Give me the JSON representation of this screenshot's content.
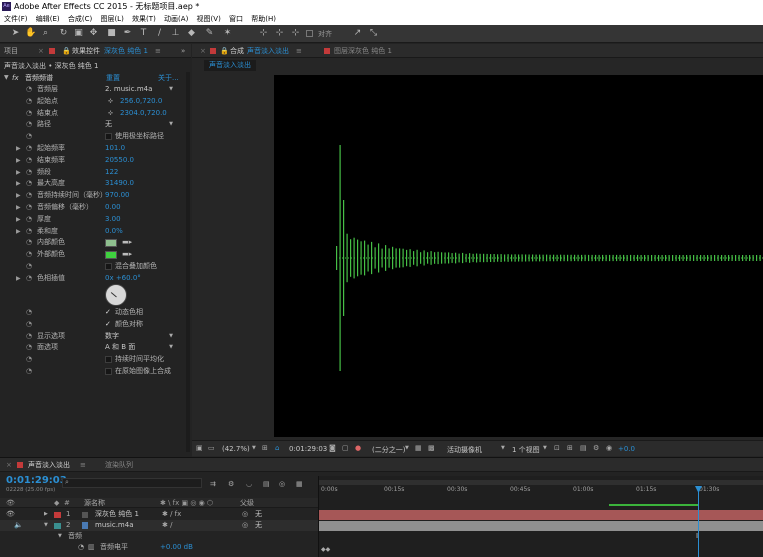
{
  "app": {
    "title": "Adobe After Effects CC 2015 - 无标题项目.aep *",
    "logo": "Ae"
  },
  "menu": [
    "文件(F)",
    "编辑(E)",
    "合成(C)",
    "图层(L)",
    "效果(T)",
    "动画(A)",
    "视图(V)",
    "窗口",
    "帮助(H)"
  ],
  "toolbar": {
    "align_label": "对齐"
  },
  "left_panel": {
    "tab_project": "项目",
    "tab_effects": "效果控件",
    "tab_layer": "深灰色 纯色 1",
    "breadcrumb": "声音淡入淡出 • 深灰色 纯色 1",
    "effect_name": "音频频谱",
    "reset": "重置",
    "about": "关于...",
    "rows": [
      {
        "label": "音频层",
        "value": "2. music.m4a",
        "kind": "dropdown"
      },
      {
        "label": "起始点",
        "value": "256.0,720.0",
        "kind": "point"
      },
      {
        "label": "结束点",
        "value": "2304.0,720.0",
        "kind": "point"
      },
      {
        "label": "路径",
        "value": "无",
        "kind": "dropdown"
      },
      {
        "label": "",
        "value": "使用极坐标路径",
        "kind": "check"
      },
      {
        "label": "起始频率",
        "value": "101.0",
        "kind": "num"
      },
      {
        "label": "结束频率",
        "value": "20550.0",
        "kind": "num"
      },
      {
        "label": "频段",
        "value": "122",
        "kind": "num"
      },
      {
        "label": "最大高度",
        "value": "31490.0",
        "kind": "num"
      },
      {
        "label": "音频持续时间（毫秒）",
        "value": "970.00",
        "kind": "num"
      },
      {
        "label": "音频偏移（毫秒）",
        "value": "0.00",
        "kind": "num"
      },
      {
        "label": "厚度",
        "value": "3.00",
        "kind": "num"
      },
      {
        "label": "柔和度",
        "value": "0.0%",
        "kind": "num"
      },
      {
        "label": "内部颜色",
        "value": "",
        "kind": "color",
        "color": "#8fc08f"
      },
      {
        "label": "外部颜色",
        "value": "",
        "kind": "color",
        "color": "#3fd13f"
      },
      {
        "label": "",
        "value": "混合叠加颜色",
        "kind": "check"
      },
      {
        "label": "色相插值",
        "value": "0x +60.0°",
        "kind": "num"
      }
    ],
    "rows2": [
      {
        "label": "",
        "value": "动态色相",
        "kind": "checked"
      },
      {
        "label": "",
        "value": "颜色对称",
        "kind": "checked"
      },
      {
        "label": "显示选项",
        "value": "数字",
        "kind": "dropdown"
      },
      {
        "label": "面选项",
        "value": "A 和 B 面",
        "kind": "dropdown"
      },
      {
        "label": "",
        "value": "持续时间平均化",
        "kind": "check"
      },
      {
        "label": "",
        "value": "在原始图像上合成",
        "kind": "check"
      }
    ]
  },
  "comp_panel": {
    "tab_label": "合成",
    "comp_name": "声音淡入淡出",
    "layer_tab": "图层",
    "layer_name": "深灰色 纯色 1",
    "sub_tab": "声音淡入淡出",
    "zoom": "(42.7%)",
    "timecode": "0:01:29:03",
    "resolution": "(二分之一)",
    "camera": "活动摄像机",
    "views": "1 个视图",
    "exposure": "+0.0"
  },
  "timeline": {
    "tab_label": "声音淡入淡出",
    "render_tab": "渲染队列",
    "timecode": "0:01:29:03",
    "frames": "02228 (25.00 fps)",
    "col_name": "源名称",
    "col_parent": "父级",
    "ticks": [
      "0:00s",
      "00:15s",
      "00:30s",
      "00:45s",
      "01:00s",
      "01:15s",
      "01:30s"
    ],
    "layers": [
      {
        "num": "1",
        "name": "深灰色 纯色 1",
        "parent": "无",
        "color": "#c33a3a"
      },
      {
        "num": "2",
        "name": "music.m4a",
        "parent": "无",
        "color": "#3a8f8f"
      }
    ],
    "audio_group": "音频",
    "audio_level_label": "音频电平",
    "audio_level_value": "+0.00 dB",
    "bar_colors": {
      "layer1": "#a65757",
      "layer2": "#909090"
    }
  },
  "spectrum": {
    "color": "#46c046",
    "bands": 122
  }
}
